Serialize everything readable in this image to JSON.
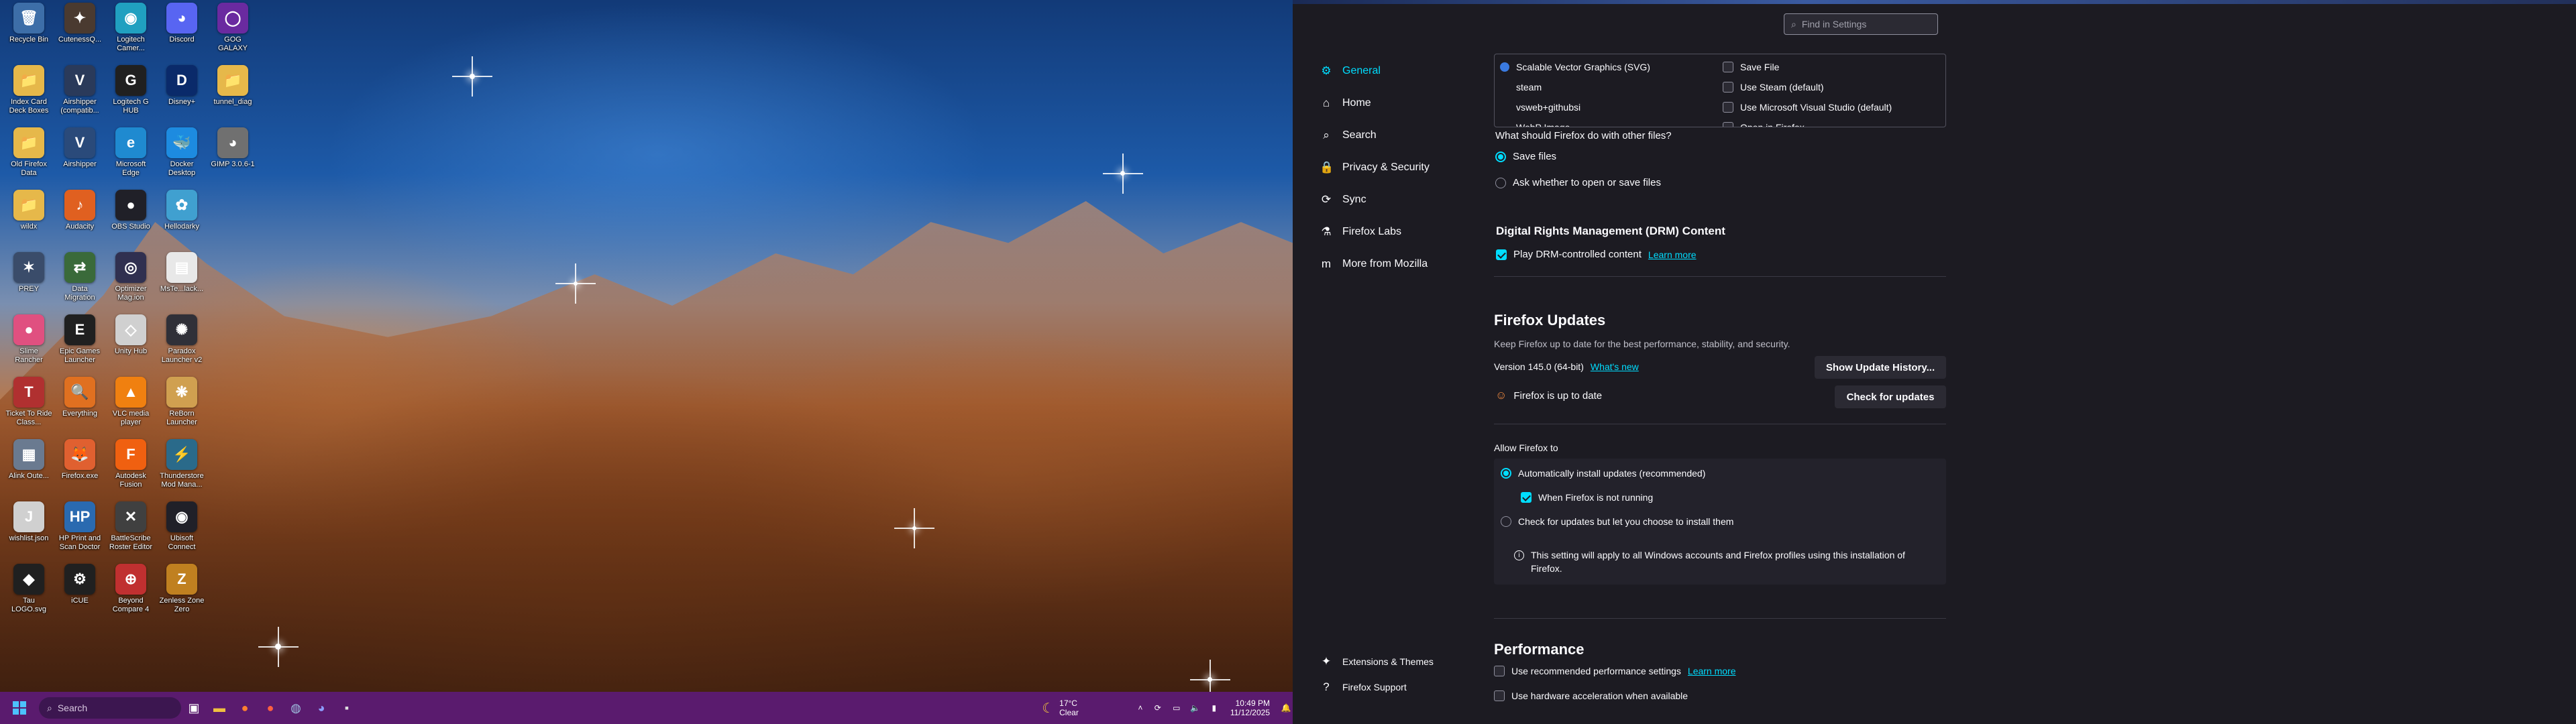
{
  "desktop": {
    "icons": [
      {
        "label": "Recycle Bin",
        "icon": "recycle-bin-icon",
        "glyph": "🗑",
        "color": "#3d6ea8"
      },
      {
        "label": "Index Card Deck Boxes",
        "icon": "folder-icon",
        "glyph": "📁",
        "color": "#e6b84a"
      },
      {
        "label": "Old Firefox Data",
        "icon": "folder-icon",
        "glyph": "📁",
        "color": "#e6b84a"
      },
      {
        "label": "wildx",
        "icon": "folder-icon",
        "glyph": "📁",
        "color": "#e6b84a"
      },
      {
        "label": "PREY",
        "icon": "prey-icon",
        "glyph": "✶",
        "color": "#3a4c6a"
      },
      {
        "label": "Slime Rancher",
        "icon": "slime-rancher-icon",
        "glyph": "●",
        "color": "#e05080"
      },
      {
        "label": "Ticket To Ride Class...",
        "icon": "ticket-to-ride-icon",
        "glyph": "T",
        "color": "#b03030"
      },
      {
        "label": "Alink Oute...",
        "icon": "alink-icon",
        "glyph": "▦",
        "color": "#6a7a90"
      },
      {
        "label": "wishlist.json",
        "icon": "json-file-icon",
        "glyph": "J",
        "color": "#d0d0d0"
      },
      {
        "label": "Tau LOGO.svg",
        "icon": "svg-file-icon",
        "glyph": "◆",
        "color": "#202020"
      },
      {
        "label": "CutenessQ...",
        "icon": "cutenessq-icon",
        "glyph": "✦",
        "color": "#4a3a30"
      },
      {
        "label": "Airshipper (compatib...",
        "icon": "airshipper-icon",
        "glyph": "V",
        "color": "#2a3a5a"
      },
      {
        "label": "Airshipper",
        "icon": "airshipper-icon",
        "glyph": "V",
        "color": "#2a4a7a"
      },
      {
        "label": "Audacity",
        "icon": "audacity-icon",
        "glyph": "♪",
        "color": "#e06020"
      },
      {
        "label": "Data Migration",
        "icon": "data-migration-icon",
        "glyph": "⇄",
        "color": "#3a6a3a"
      },
      {
        "label": "Epic Games Launcher",
        "icon": "epic-games-icon",
        "glyph": "E",
        "color": "#202020"
      },
      {
        "label": "Everything",
        "icon": "everything-icon",
        "glyph": "🔍",
        "color": "#e07020"
      },
      {
        "label": "Firefox.exe",
        "icon": "firefox-icon",
        "glyph": "🦊",
        "color": "#e06030"
      },
      {
        "label": "HP Print and Scan Doctor",
        "icon": "hp-icon",
        "glyph": "HP",
        "color": "#2a6ab0"
      },
      {
        "label": "iCUE",
        "icon": "icue-icon",
        "glyph": "⚙",
        "color": "#202020"
      },
      {
        "label": "Logitech Camer...",
        "icon": "logitech-icon",
        "glyph": "◉",
        "color": "#20a0c0"
      },
      {
        "label": "Logitech G HUB",
        "icon": "ghub-icon",
        "glyph": "G",
        "color": "#202020"
      },
      {
        "label": "Microsoft Edge",
        "icon": "edge-icon",
        "glyph": "e",
        "color": "#1f8ad0"
      },
      {
        "label": "OBS Studio",
        "icon": "obs-icon",
        "glyph": "●",
        "color": "#202028"
      },
      {
        "label": "Optimizer Mag.ion",
        "icon": "optimizer-icon",
        "glyph": "◎",
        "color": "#303050"
      },
      {
        "label": "Unity Hub",
        "icon": "unity-hub-icon",
        "glyph": "◇",
        "color": "#d0d0d0"
      },
      {
        "label": "VLC media player",
        "icon": "vlc-icon",
        "glyph": "▲",
        "color": "#f08010"
      },
      {
        "label": "Autodesk Fusion",
        "icon": "fusion-icon",
        "glyph": "F",
        "color": "#f06010"
      },
      {
        "label": "BattleScribe Roster Editor",
        "icon": "battlescribe-icon",
        "glyph": "✕",
        "color": "#404040"
      },
      {
        "label": "Beyond Compare 4",
        "icon": "beyond-compare-icon",
        "glyph": "⊕",
        "color": "#c03030"
      },
      {
        "label": "Discord",
        "icon": "discord-icon",
        "glyph": "◕",
        "color": "#5865f2"
      },
      {
        "label": "Disney+",
        "icon": "disney-icon",
        "glyph": "D",
        "color": "#0a2a6a"
      },
      {
        "label": "Docker Desktop",
        "icon": "docker-icon",
        "glyph": "🐳",
        "color": "#1d8be0"
      },
      {
        "label": "Hellodarky",
        "icon": "hello-icon",
        "glyph": "✿",
        "color": "#40a0d0"
      },
      {
        "label": "MsTe...lack...",
        "icon": "document-icon",
        "glyph": "▤",
        "color": "#e8e8e8"
      },
      {
        "label": "Paradox Launcher v2",
        "icon": "paradox-icon",
        "glyph": "✺",
        "color": "#303038"
      },
      {
        "label": "ReBorn Launcher",
        "icon": "reborn-icon",
        "glyph": "❋",
        "color": "#d0a050"
      },
      {
        "label": "Thunderstore Mod Mana...",
        "icon": "thunderstore-icon",
        "glyph": "⚡",
        "color": "#2a6a8a"
      },
      {
        "label": "Ubisoft Connect",
        "icon": "ubisoft-icon",
        "glyph": "◉",
        "color": "#202028"
      },
      {
        "label": "Zenless Zone Zero",
        "icon": "zzz-icon",
        "glyph": "Z",
        "color": "#c08020"
      },
      {
        "label": "GOG GALAXY",
        "icon": "gog-icon",
        "glyph": "◯",
        "color": "#6a2aa0"
      },
      {
        "label": "tunnel_diag",
        "icon": "folder-icon",
        "glyph": "📁",
        "color": "#e6b84a"
      },
      {
        "label": "GIMP 3.0.6-1",
        "icon": "gimp-icon",
        "glyph": "◕",
        "color": "#707070"
      }
    ]
  },
  "taskbar": {
    "search_placeholder": "Search",
    "weather_temp": "17°C",
    "weather_desc": "Clear",
    "time": "10:49 PM",
    "date": "11/12/2025"
  },
  "settings": {
    "find_placeholder": "Find in Settings",
    "nav": [
      {
        "label": "General",
        "icon": "gear-icon",
        "glyph": "⚙"
      },
      {
        "label": "Home",
        "icon": "home-icon",
        "glyph": "⌂"
      },
      {
        "label": "Search",
        "icon": "search-icon",
        "glyph": "⌕"
      },
      {
        "label": "Privacy & Security",
        "icon": "lock-icon",
        "glyph": "🔒"
      },
      {
        "label": "Sync",
        "icon": "sync-icon",
        "glyph": "⟳"
      },
      {
        "label": "Firefox Labs",
        "icon": "flask-icon",
        "glyph": "⚗"
      },
      {
        "label": "More from Mozilla",
        "icon": "mozilla-icon",
        "glyph": "m"
      }
    ],
    "footer": [
      {
        "label": "Extensions & Themes",
        "icon": "puzzle-icon",
        "glyph": "✦"
      },
      {
        "label": "Firefox Support",
        "icon": "help-icon",
        "glyph": "?"
      }
    ],
    "apps_table": {
      "types": [
        "Scalable Vector Graphics (SVG)",
        "steam",
        "vsweb+githubsi",
        "WebP Image"
      ],
      "actions": [
        "Save File",
        "Use Steam (default)",
        "Use Microsoft Visual Studio (default)",
        "Open in Firefox"
      ]
    },
    "other_files": {
      "question": "What should Firefox do with other files?",
      "option_save": "Save files",
      "option_ask": "Ask whether to open or save files"
    },
    "drm": {
      "title": "Digital Rights Management (DRM) Content",
      "checkbox": "Play DRM-controlled content",
      "link": "Learn more"
    },
    "updates": {
      "title": "Firefox Updates",
      "desc": "Keep Firefox up to date for the best performance, stability, and security.",
      "version": "Version 145.0 (64-bit)",
      "whats_new": "What's new",
      "history_button": "Show Update History...",
      "status": "Firefox is up to date",
      "check_button": "Check for updates",
      "allow_label": "Allow Firefox to",
      "auto_option": "Automatically install updates (recommended)",
      "not_running": "When Firefox is not running",
      "manual_option": "Check for updates but let you choose to install them",
      "info": "This setting will apply to all Windows accounts and Firefox profiles using this installation of Firefox."
    },
    "performance": {
      "title": "Performance",
      "recommended": "Use recommended performance settings",
      "link": "Learn more",
      "hardware": "Use hardware acceleration when available"
    }
  }
}
